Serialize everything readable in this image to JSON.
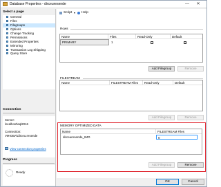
{
  "window": {
    "title": "Database Properties - dirceuresende"
  },
  "left": {
    "select_page_heading": "Select a page",
    "pages": [
      {
        "label": "General"
      },
      {
        "label": "Files"
      },
      {
        "label": "Filegroups"
      },
      {
        "label": "Options"
      },
      {
        "label": "Change Tracking"
      },
      {
        "label": "Permissions"
      },
      {
        "label": "Extended Properties"
      },
      {
        "label": "Mirroring"
      },
      {
        "label": "Transaction Log Shipping"
      },
      {
        "label": "Query Store"
      }
    ],
    "connection_heading": "Connection",
    "server_label": "Server:",
    "server_value": "localhost\\sql2016",
    "connection_label": "Connection:",
    "connection_value": "VM-DBA\\dirceu.resende",
    "view_props_link": "View connection properties",
    "progress_heading": "Progress",
    "progress_status": "Ready"
  },
  "toolbar": {
    "script_label": "Script",
    "help_label": "Help"
  },
  "rows_section": {
    "label": "Rows",
    "columns": [
      "Name",
      "Files",
      "Read-Only",
      "Default"
    ],
    "rows": [
      {
        "name": "PRIMARY",
        "files": "1",
        "read_only": false,
        "default": true
      }
    ],
    "add_button": "Add Filegroup",
    "remove_button": "Remove"
  },
  "filestream_section": {
    "label": "FILESTREAM",
    "columns": [
      "Name",
      "FILESTREAM Files",
      "Read-Only",
      "Default"
    ],
    "add_button": "Add Filegroup",
    "remove_button": "Remove"
  },
  "memory_section": {
    "label": "MEMORY OPTIMIZED DATA",
    "columns": [
      "Name",
      "FILESTREAM Files"
    ],
    "rows": [
      {
        "name": "dirceuresende_IMO",
        "files": "0"
      }
    ],
    "add_button": "Add Filegroup",
    "remove_button": "Remove"
  },
  "footer": {
    "ok_button": "OK",
    "cancel_button": "Cancel"
  },
  "colors": {
    "highlight_border": "#e0262f",
    "selection": "#cce8ff",
    "link": "#0066cc"
  }
}
